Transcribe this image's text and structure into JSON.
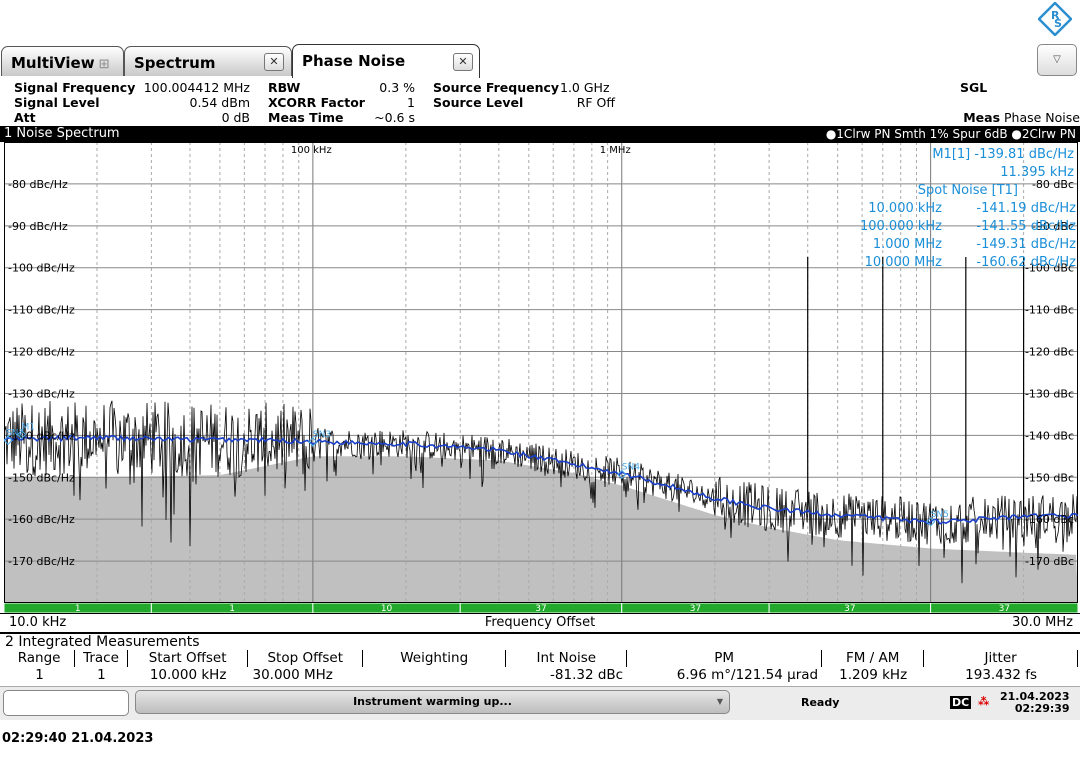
{
  "tabs": [
    {
      "label": "MultiView"
    },
    {
      "label": "Spectrum"
    },
    {
      "label": "Phase Noise"
    }
  ],
  "info": {
    "signal_frequency": {
      "label": "Signal Frequency",
      "value": "100.004412 MHz"
    },
    "signal_level": {
      "label": "Signal Level",
      "value": "0.54 dBm"
    },
    "att": {
      "label": "Att",
      "value": "0 dB"
    },
    "rbw": {
      "label": "RBW",
      "value": "0.3 %"
    },
    "xcorr": {
      "label": "XCORR Factor",
      "value": "1"
    },
    "meas_time": {
      "label": "Meas Time",
      "value": "~0.6 s"
    },
    "source_frequency": {
      "label": "Source Frequency",
      "value": "1.0 GHz"
    },
    "source_level": {
      "label": "Source Level",
      "value": "RF Off"
    },
    "sgl": "SGL",
    "meas_label": "Meas",
    "meas_value": "Phase Noise"
  },
  "diagram": {
    "title": "1 Noise Spectrum",
    "trace_info": "●1Clrw PN Smth 1% Spur 6dB ●2Clrw PN",
    "start": "10.0 kHz",
    "stop": "30.0 MHz",
    "xlabel": "Frequency Offset"
  },
  "marker": {
    "m1_label": "M1[1]",
    "m1_level": "-139.81 dBc/Hz",
    "m1_freq": "11.395 kHz",
    "spot_title": "Spot Noise [T1]",
    "spot": [
      {
        "freq": "10.000 kHz",
        "level": "-141.19 dBc/Hz"
      },
      {
        "freq": "100.000 kHz",
        "level": "-141.55 dBc/Hz"
      },
      {
        "freq": "1.000 MHz",
        "level": "-149.31 dBc/Hz"
      },
      {
        "freq": "10.000 MHz",
        "level": "-160.62 dBc/Hz"
      }
    ]
  },
  "chart_data": {
    "type": "line",
    "xscale": "log",
    "xlim": [
      10000,
      30000000
    ],
    "ylim": [
      -180,
      -70
    ],
    "grid": true,
    "yticks_left": [
      "-80 dBc/Hz",
      "-90 dBc/Hz",
      "-100 dBc/Hz",
      "-110 dBc/Hz",
      "-120 dBc/Hz",
      "-130 dBc/Hz",
      "-140 dBc/Hz",
      "-150 dBc/Hz",
      "-160 dBc/Hz",
      "-170 dBc/Hz"
    ],
    "yticks_right": [
      "-80 dBc",
      "-90 dBc",
      "-100 dBc",
      "-110 dBc",
      "-120 dBc",
      "-130 dBc",
      "-140 dBc",
      "-150 dBc",
      "-160 dBc",
      "-170 dBc"
    ],
    "ytick_values": [
      -80,
      -90,
      -100,
      -110,
      -120,
      -130,
      -140,
      -150,
      -160,
      -170
    ],
    "xtick_labels": [
      {
        "label": "100 kHz",
        "value": 100000
      },
      {
        "label": "1 MHz",
        "value": 1000000
      }
    ],
    "trace_color": "#000000",
    "smooth_color": "#1a3fc8",
    "floor_color": "#c0c0c0",
    "series": [
      {
        "name": "1Clrw PN Smth 1%",
        "x": [
          10000,
          20000,
          40000,
          60000,
          100000,
          200000,
          400000,
          700000,
          1000000,
          2000000,
          3000000,
          5000000,
          10000000,
          20000000,
          30000000
        ],
        "y": [
          -141,
          -140.5,
          -141,
          -141,
          -141.5,
          -142,
          -143.5,
          -147,
          -149,
          -155,
          -157.5,
          -159,
          -160.6,
          -159.5,
          -159
        ]
      },
      {
        "name": "2Clrw PN",
        "x": [
          10000,
          20000,
          50000,
          100000,
          200000,
          400000,
          700000,
          1000000,
          2000000,
          3000000,
          5000000,
          10000000,
          20000000,
          30000000
        ],
        "y": [
          -150,
          -150,
          -149.5,
          -145,
          -145,
          -146,
          -149,
          -152,
          -159,
          -162,
          -165,
          -167,
          -168,
          -168.5
        ]
      }
    ],
    "markers": [
      {
        "label": "M1",
        "x": 11395,
        "y": -139.81
      },
      {
        "label": "SN2",
        "x": 10000,
        "y": -141.19
      },
      {
        "label": "SN3",
        "x": 100000,
        "y": -141.55
      },
      {
        "label": "SN4",
        "x": 1000000,
        "y": -149.31
      },
      {
        "label": "SN5",
        "x": 10000000,
        "y": -160.62
      }
    ],
    "spurs_x": [
      4000000,
      7000000,
      13000000,
      20000000
    ],
    "segments": [
      {
        "value": "1",
        "start": 10000,
        "end": 30000
      },
      {
        "value": "1",
        "start": 30000,
        "end": 100000
      },
      {
        "value": "10",
        "start": 100000,
        "end": 300000
      },
      {
        "value": "37",
        "start": 300000,
        "end": 1000000
      },
      {
        "value": "37",
        "start": 1000000,
        "end": 3000000
      },
      {
        "value": "37",
        "start": 3000000,
        "end": 10000000
      },
      {
        "value": "37",
        "start": 10000000,
        "end": 30000000
      }
    ]
  },
  "integrated": {
    "title": "2 Integrated Measurements",
    "headers": [
      "Range",
      "Trace",
      "Start Offset",
      "Stop Offset",
      "Weighting",
      "Int Noise",
      "PM",
      "FM / AM",
      "Jitter"
    ],
    "rows": [
      [
        "1",
        "1",
        "10.000 kHz",
        "30.000 MHz",
        "",
        "-81.32 dBc",
        "6.96 m°/121.54 µrad",
        "1.209 kHz",
        "193.432 fs"
      ]
    ]
  },
  "status": {
    "message": "Instrument warming up...",
    "ready": "Ready",
    "dc": "DC",
    "date": "21.04.2023",
    "time": "02:29:39"
  },
  "footer_timestamp": "02:29:40  21.04.2023"
}
